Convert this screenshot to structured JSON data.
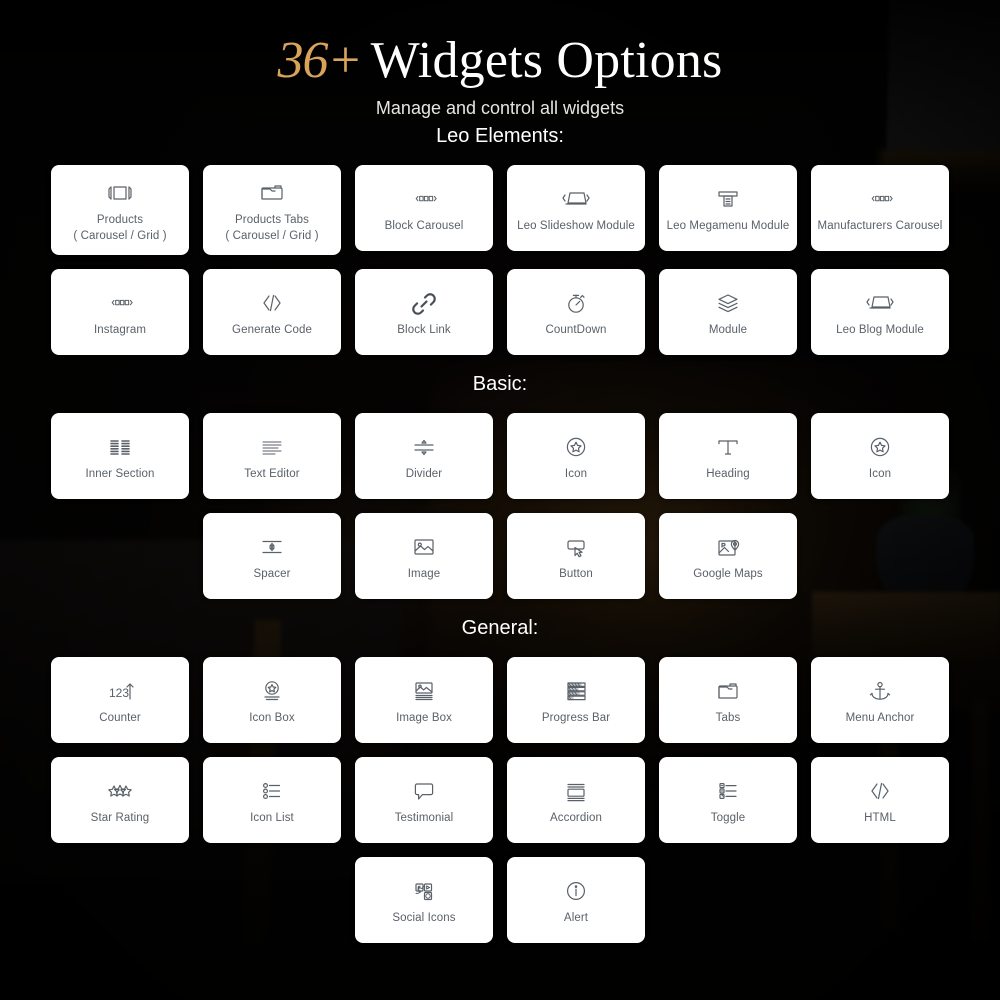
{
  "hero": {
    "count": "36+",
    "title": "Widgets Options",
    "subtitle": "Manage and control all widgets"
  },
  "colors": {
    "accent": "#d8a45c",
    "card_bg": "#ffffff",
    "card_label": "#5a6168",
    "icon_stroke": "#5a6168",
    "page_bg": "#090606",
    "heading": "#ffffff"
  },
  "sections": [
    {
      "title": "Leo Elements:",
      "rows": [
        [
          {
            "label": "Products\n( Carousel / Grid )",
            "icon": "products-carousel-icon"
          },
          {
            "label": "Products Tabs\n( Carousel / Grid )",
            "icon": "products-tabs-icon"
          },
          {
            "label": "Block Carousel",
            "icon": "block-carousel-icon"
          },
          {
            "label": "Leo Slideshow Module",
            "icon": "slideshow-icon"
          },
          {
            "label": "Leo Megamenu Module",
            "icon": "megamenu-icon"
          },
          {
            "label": "Manufacturers Carousel",
            "icon": "block-carousel-icon"
          }
        ],
        [
          {
            "label": "Instagram",
            "icon": "block-carousel-icon"
          },
          {
            "label": "Generate Code",
            "icon": "code-icon"
          },
          {
            "label": "Block Link",
            "icon": "link-icon"
          },
          {
            "label": "CountDown",
            "icon": "stopwatch-icon"
          },
          {
            "label": "Module",
            "icon": "layers-icon"
          },
          {
            "label": "Leo Blog Module",
            "icon": "slideshow-icon"
          }
        ]
      ]
    },
    {
      "title": "Basic:",
      "rows": [
        [
          {
            "label": "Inner Section",
            "icon": "inner-section-icon"
          },
          {
            "label": "Text Editor",
            "icon": "text-editor-icon"
          },
          {
            "label": "Divider",
            "icon": "divider-icon"
          },
          {
            "label": "Icon",
            "icon": "star-circle-icon"
          },
          {
            "label": "Heading",
            "icon": "heading-t-icon"
          },
          {
            "label": "Icon",
            "icon": "star-circle-icon"
          }
        ],
        [
          {
            "label": "Spacer",
            "icon": "spacer-icon"
          },
          {
            "label": "Image",
            "icon": "image-icon"
          },
          {
            "label": "Button",
            "icon": "button-icon"
          },
          {
            "label": "Google Maps",
            "icon": "google-maps-icon"
          }
        ]
      ]
    },
    {
      "title": "General:",
      "rows": [
        [
          {
            "label": "Counter",
            "icon": "counter-icon"
          },
          {
            "label": "Icon Box",
            "icon": "icon-box-icon"
          },
          {
            "label": "Image Box",
            "icon": "image-box-icon"
          },
          {
            "label": "Progress Bar",
            "icon": "progress-bar-icon"
          },
          {
            "label": "Tabs",
            "icon": "tabs-icon"
          },
          {
            "label": "Menu Anchor",
            "icon": "anchor-icon"
          }
        ],
        [
          {
            "label": "Star Rating",
            "icon": "star-rating-icon"
          },
          {
            "label": "Icon List",
            "icon": "icon-list-icon"
          },
          {
            "label": "Testimonial",
            "icon": "testimonial-icon"
          },
          {
            "label": "Accordion",
            "icon": "accordion-icon"
          },
          {
            "label": "Toggle",
            "icon": "toggle-icon"
          },
          {
            "label": "HTML",
            "icon": "code-icon"
          }
        ],
        [
          {
            "label": "Social Icons",
            "icon": "social-icons-icon"
          },
          {
            "label": "Alert",
            "icon": "alert-info-icon"
          }
        ]
      ]
    }
  ]
}
